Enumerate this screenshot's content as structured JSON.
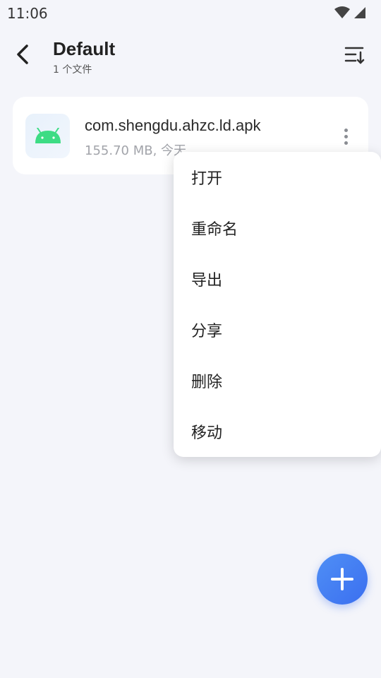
{
  "status": {
    "time": "11:06"
  },
  "header": {
    "title": "Default",
    "subtitle": "1 个文件"
  },
  "file": {
    "name": "com.shengdu.ahzc.ld.apk",
    "meta": "155.70 MB, 今天"
  },
  "menu": {
    "items": [
      {
        "label": "打开"
      },
      {
        "label": "重命名"
      },
      {
        "label": "导出"
      },
      {
        "label": "分享"
      },
      {
        "label": "删除"
      },
      {
        "label": "移动"
      }
    ]
  },
  "icons": {
    "back": "back-arrow-icon",
    "sort": "sort-icon",
    "file": "android-icon",
    "more": "more-vertical-icon",
    "fab": "plus-icon"
  },
  "colors": {
    "accent": "#3b6ff0",
    "android": "#3ddc84"
  }
}
